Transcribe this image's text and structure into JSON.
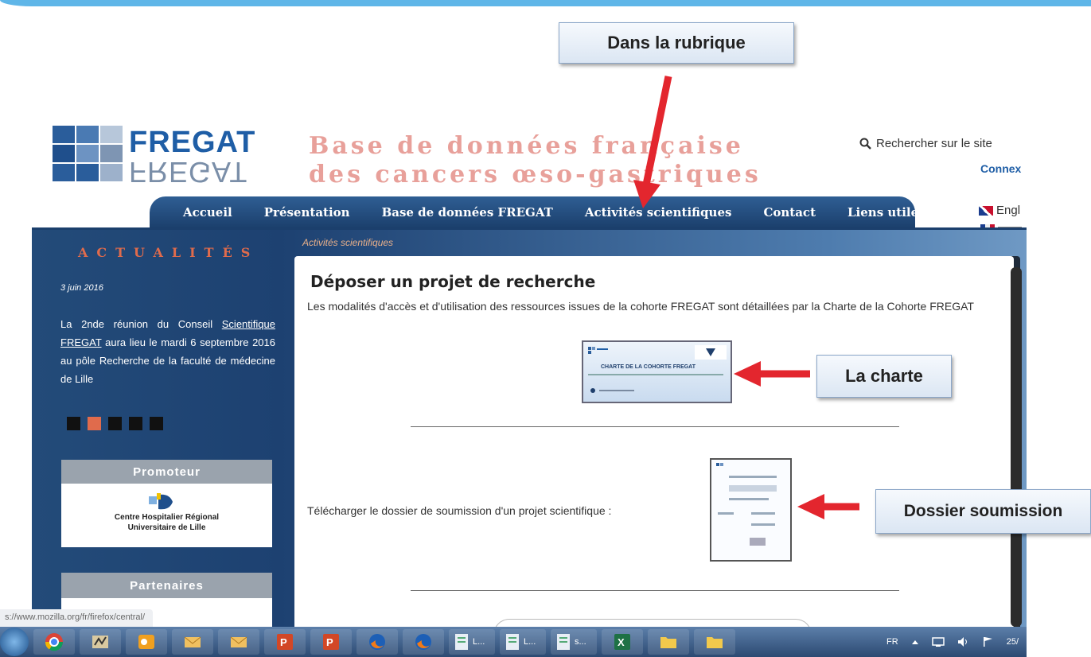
{
  "callouts": {
    "rubrique": "Dans la rubrique",
    "charte": "La charte",
    "dossier": "Dossier soumission"
  },
  "header": {
    "brand": "FREGAT",
    "brand_mirror": "FREGAT",
    "tagline_line1": "Base de données française",
    "tagline_line2": "des cancers œso-gastriques",
    "search_label": "Rechercher sur le site",
    "connexion_label": "Connex",
    "language_label": "Engl"
  },
  "nav": {
    "items": [
      "Accueil",
      "Présentation",
      "Base de données FREGAT",
      "Activités scientifiques",
      "Contact",
      "Liens utiles"
    ]
  },
  "sidebar": {
    "actualites_title": "ACTUALITÉS",
    "news_date": "3 juin 2016",
    "news_text_1": "La 2nde réunion du Conseil",
    "news_link": "Scientifique FREGAT",
    "news_text_2": "aura lieu le mardi 6 septembre 2016 au pôle Recherche de la faculté de médecine de Lille",
    "promoteur_label": "Promoteur",
    "chr_line1": "Centre Hospitalier Régional",
    "chr_line2": "Universitaire de Lille",
    "partenaires_label": "Partenaires"
  },
  "breadcrumb": "Activités scientifiques",
  "content": {
    "title": "Déposer un projet de recherche",
    "intro": "Les modalités d'accès et d'utilisation des ressources issues de la cohorte FREGAT sont détaillées par la Charte de la Cohorte FREGAT",
    "charte_thumb_title": "CHARTE DE LA COHORTE FREGAT",
    "download_text": "Télécharger le dossier de soumission d'un projet scientifique :"
  },
  "status_url": "s://www.mozilla.org/fr/firefox/central/",
  "taskbar": {
    "apps": [
      "L...",
      "L...",
      "s..."
    ],
    "tray_lang": "FR",
    "tray_clock": "25/"
  },
  "colors": {
    "brand_blue": "#1f5ea6",
    "nav_blue": "#1b3f6c",
    "accent_orange": "#e06b4c",
    "arrow_red": "#e3262e"
  }
}
